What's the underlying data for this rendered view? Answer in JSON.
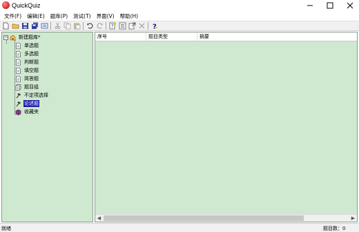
{
  "window": {
    "title": "QuickQuiz",
    "icon": "quickquiz-app-icon"
  },
  "menu": [
    {
      "id": "file",
      "label": "文件(F)"
    },
    {
      "id": "edit",
      "label": "编辑(E)"
    },
    {
      "id": "bank",
      "label": "题库(P)"
    },
    {
      "id": "test",
      "label": "测试(T)"
    },
    {
      "id": "view",
      "label": "界面(V)"
    },
    {
      "id": "help",
      "label": "帮助(H)"
    }
  ],
  "toolbar": {
    "groups": [
      [
        "new-icon",
        "open-icon",
        "save-icon",
        "save-all-icon",
        "properties-icon"
      ],
      [
        "cut-icon",
        "copy-icon",
        "paste-icon"
      ],
      [
        "undo-icon",
        "redo-icon"
      ],
      [
        "new-question-icon",
        "import-icon",
        "export-icon",
        "delete-icon"
      ],
      [
        "help-icon"
      ]
    ]
  },
  "tree": {
    "root": {
      "label": "新建题库*",
      "expanded": true
    },
    "items": [
      {
        "label": "单选题",
        "icon": "document-icon"
      },
      {
        "label": "多选题",
        "icon": "document-icon"
      },
      {
        "label": "判断题",
        "icon": "document-icon"
      },
      {
        "label": "填空题",
        "icon": "document-icon"
      },
      {
        "label": "简答题",
        "icon": "document-icon"
      },
      {
        "label": "题目组",
        "icon": "document-group-icon"
      },
      {
        "label": "不定项选择",
        "icon": "hammer-icon"
      },
      {
        "label": "论述题",
        "icon": "hammer-icon",
        "selected": true
      },
      {
        "label": "收藏夹",
        "icon": "book-icon"
      }
    ]
  },
  "list": {
    "columns": [
      "序号",
      "题目类型",
      "摘要"
    ]
  },
  "status": {
    "left": "就绪",
    "right": "题目数：0"
  },
  "colors": {
    "pane_background": "#cfe8d0",
    "selection": "#1a1aa6"
  }
}
